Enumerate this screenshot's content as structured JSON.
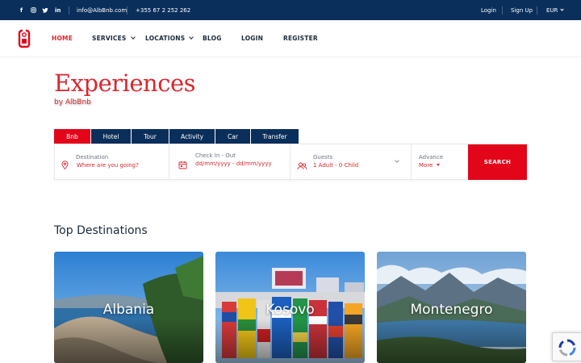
{
  "topbar": {
    "social": [
      "f",
      "ig",
      "tw",
      "in"
    ],
    "email": "info@AlbBnb.com",
    "phone": "+355 67 2 252 262",
    "login": "Login",
    "signup": "Sign Up",
    "currency": "EUR"
  },
  "nav": {
    "home": "HOME",
    "services": "SERVICES",
    "locations": "LOCATIONS",
    "blog": "BLOG",
    "login": "LOGIN",
    "register": "REGISTER"
  },
  "hero": {
    "title": "Experiences",
    "subtitle": "by AlbBnb"
  },
  "tabs": [
    "Bnb",
    "Hotel",
    "Tour",
    "Activity",
    "Car",
    "Transfer"
  ],
  "search": {
    "destination_label": "Destination",
    "destination_placeholder": "Where are you going?",
    "dates_label": "Check In - Out",
    "dates_value": "dd/mm/yyyy - dd/mm/yyyy",
    "guests_label": "Guests",
    "guests_value": "1 Adult - 0 Child",
    "advance_label": "Advance",
    "advance_value": "More",
    "button": "SEARCH"
  },
  "destinations": {
    "title": "Top Destinations",
    "cards": [
      "Albania",
      "Kosovo",
      "Montenegro"
    ]
  },
  "colors": {
    "primary_red": "#e3051a",
    "navy": "#0b2f5b"
  }
}
